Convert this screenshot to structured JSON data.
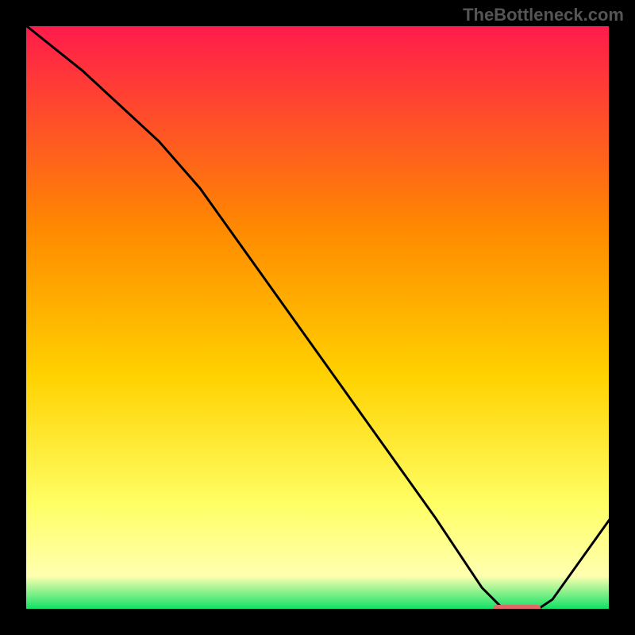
{
  "watermark": "TheBottleneck.com",
  "chart_data": {
    "type": "line",
    "title": "",
    "xlabel": "",
    "ylabel": "",
    "xlim": [
      0,
      100
    ],
    "ylim": [
      0,
      100
    ],
    "series": [
      {
        "name": "curve",
        "x": [
          0,
          10,
          23,
          30,
          40,
          50,
          60,
          70,
          78,
          82,
          87,
          90,
          100
        ],
        "y": [
          100,
          92,
          80,
          72,
          58,
          44,
          30,
          16,
          4,
          0,
          0,
          2,
          16
        ]
      }
    ],
    "optimal_marker": {
      "x_start": 80,
      "x_end": 88,
      "y": 0
    },
    "gradient": {
      "top": "#ff1a4d",
      "upper_mid": "#ff8a00",
      "mid": "#ffd200",
      "lower_mid": "#ffff66",
      "pale": "#ffffb0",
      "green": "#00e060"
    }
  }
}
